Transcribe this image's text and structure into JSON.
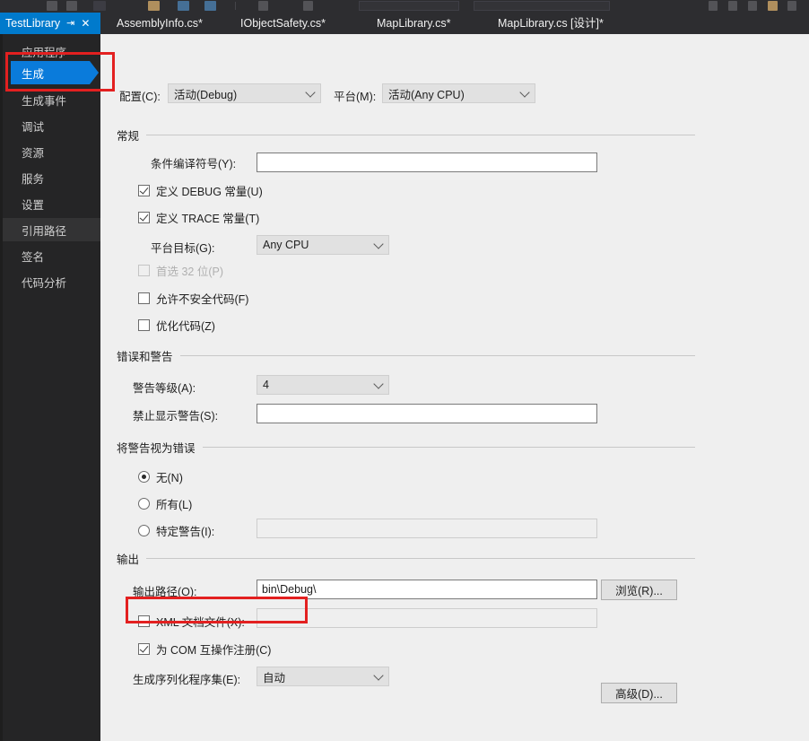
{
  "window": {
    "tabs": [
      {
        "label": "TestLibrary",
        "active": true,
        "pin_icon": "pin-icon",
        "close_icon": "close-icon"
      },
      {
        "label": "AssemblyInfo.cs*",
        "active": false
      },
      {
        "label": "IObjectSafety.cs*",
        "active": false
      },
      {
        "label": "MapLibrary.cs*",
        "active": false
      },
      {
        "label": "MapLibrary.cs [设计]*",
        "active": false
      }
    ]
  },
  "sidebar": {
    "items": [
      {
        "label": "应用程序",
        "state": "normal"
      },
      {
        "label": "生成",
        "state": "selected"
      },
      {
        "label": "生成事件",
        "state": "normal"
      },
      {
        "label": "调试",
        "state": "normal"
      },
      {
        "label": "资源",
        "state": "normal"
      },
      {
        "label": "服务",
        "state": "normal"
      },
      {
        "label": "设置",
        "state": "normal"
      },
      {
        "label": "引用路径",
        "state": "hover"
      },
      {
        "label": "签名",
        "state": "normal"
      },
      {
        "label": "代码分析",
        "state": "normal"
      }
    ]
  },
  "top_bar": {
    "configuration_label": "配置(C):",
    "configuration_value": "活动(Debug)",
    "platform_label": "平台(M):",
    "platform_value": "活动(Any CPU)"
  },
  "general": {
    "group_title": "常规",
    "conditional_symbols_label": "条件编译符号(Y):",
    "conditional_symbols_value": "",
    "define_debug_label": "定义 DEBUG 常量(U)",
    "define_debug_checked": true,
    "define_trace_label": "定义 TRACE 常量(T)",
    "define_trace_checked": true,
    "platform_target_label": "平台目标(G):",
    "platform_target_value": "Any CPU",
    "prefer_32bit_label": "首选 32 位(P)",
    "prefer_32bit_checked": false,
    "prefer_32bit_disabled": true,
    "allow_unsafe_label": "允许不安全代码(F)",
    "allow_unsafe_checked": false,
    "optimize_code_label": "优化代码(Z)",
    "optimize_code_checked": false
  },
  "errors_warnings": {
    "group_title": "错误和警告",
    "warning_level_label": "警告等级(A):",
    "warning_level_value": "4",
    "suppress_warnings_label": "禁止显示警告(S):",
    "suppress_warnings_value": ""
  },
  "treat_warnings": {
    "group_title": "将警告视为错误",
    "none_label": "无(N)",
    "all_label": "所有(L)",
    "specific_label": "特定警告(I):",
    "specific_value": "",
    "selected": "none"
  },
  "output": {
    "group_title": "输出",
    "output_path_label": "输出路径(O):",
    "output_path_value": "bin\\Debug\\",
    "browse_button": "浏览(R)...",
    "xml_doc_label": "XML 文档文件(X):",
    "xml_doc_checked": false,
    "xml_doc_value": "",
    "register_com_label": "为 COM 互操作注册(C)",
    "register_com_checked": true,
    "serialization_label": "生成序列化程序集(E):",
    "serialization_value": "自动"
  },
  "footer": {
    "advanced_button": "高级(D)..."
  },
  "colors": {
    "accent_blue": "#007acc",
    "sidebar_bg": "#252526",
    "selected_item": "#0a7bdb",
    "highlight_red": "#e32020",
    "pane_bg": "#efefef"
  }
}
